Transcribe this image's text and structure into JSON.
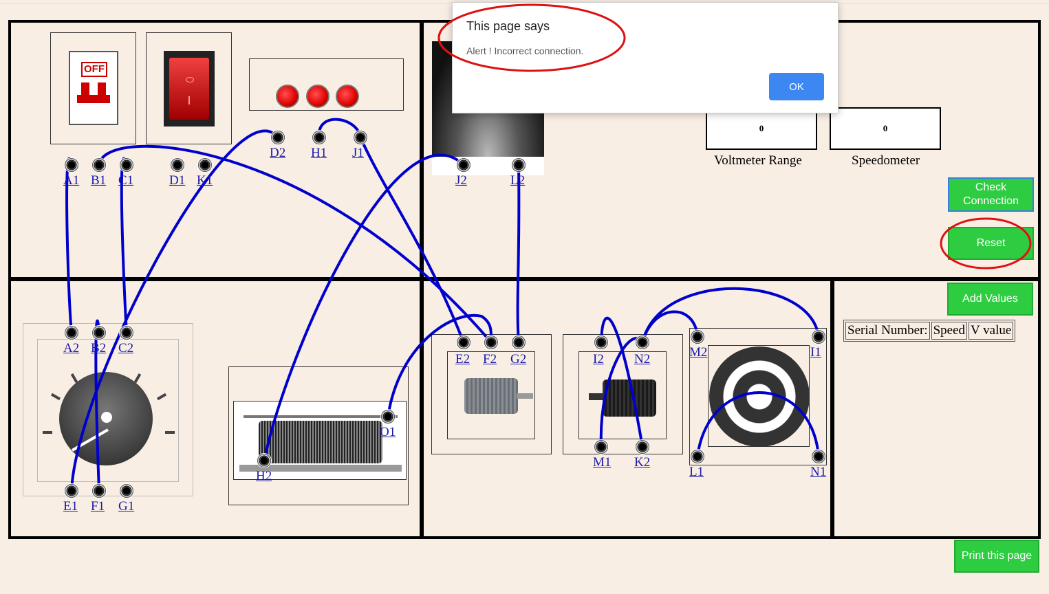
{
  "dialog": {
    "title": "This page says",
    "message": "Alert ! Incorrect connection.",
    "ok_label": "OK"
  },
  "switch": {
    "off_text": "OFF"
  },
  "meters": [
    {
      "value": "0",
      "label": "Voltmeter Range"
    },
    {
      "value": "0",
      "label": "Speedometer"
    }
  ],
  "buttons": {
    "check_connection": "Check Connection",
    "reset": "Reset",
    "add_values": "Add Values",
    "print_page": "Print this page"
  },
  "table": {
    "headers": [
      "Serial Number:",
      "Speed",
      "V value"
    ]
  },
  "terminals": {
    "A1": "A1",
    "B1": "B1",
    "C1": "C1",
    "D1": "D1",
    "K1": "K1",
    "D2": "D2",
    "H1": "H1",
    "J1": "J1",
    "J2": "J2",
    "L2": "L2",
    "A2": "A2",
    "B2": "B2",
    "C2": "C2",
    "E1": "E1",
    "F1": "F1",
    "G1": "G1",
    "O1": "O1",
    "H2": "H2",
    "E2": "E2",
    "F2": "F2",
    "G2": "G2",
    "I2": "I2",
    "N2": "N2",
    "M1": "M1",
    "K2": "K2",
    "M2": "M2",
    "I1": "I1",
    "L1": "L1",
    "N1": "N1"
  },
  "colors": {
    "wire": "#0000cc",
    "button_green": "#2ecc40",
    "annotation_red": "#dd1111",
    "ok_blue": "#3c87f2"
  }
}
